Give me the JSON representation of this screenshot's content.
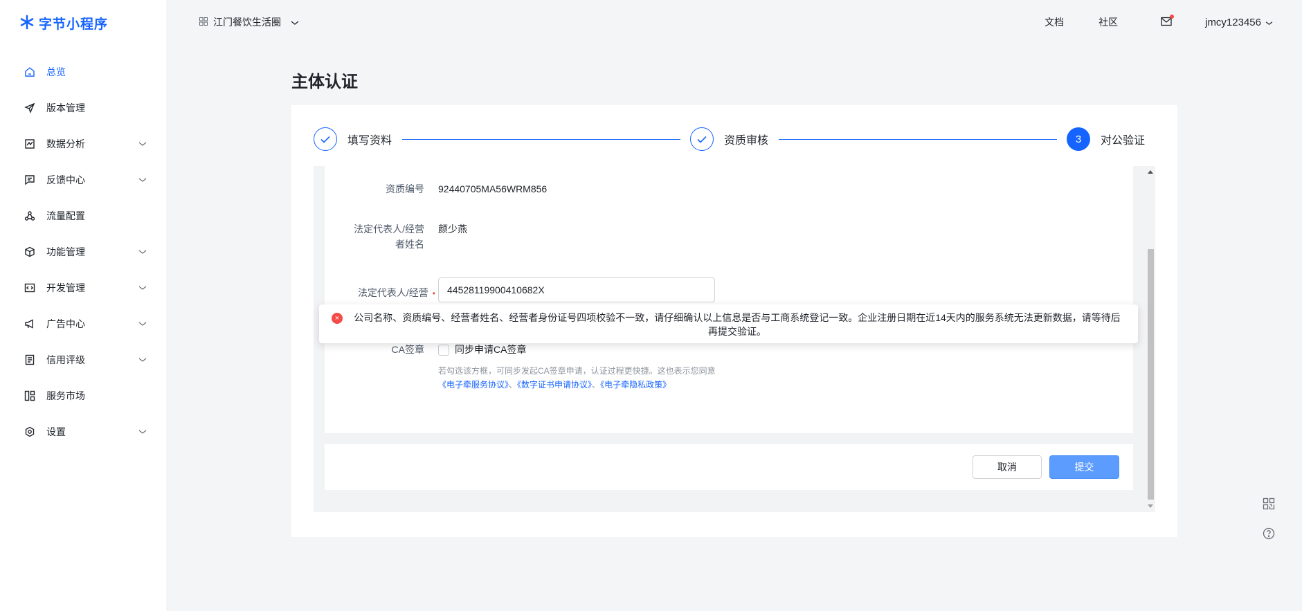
{
  "app": {
    "logo_text": "字节小程序",
    "brand_color": "#1664ff"
  },
  "sidebar": {
    "items": [
      {
        "label": "总览",
        "icon": "home-icon",
        "active": true,
        "expandable": false
      },
      {
        "label": "版本管理",
        "icon": "send-icon",
        "active": false,
        "expandable": false
      },
      {
        "label": "数据分析",
        "icon": "chart-icon",
        "active": false,
        "expandable": true
      },
      {
        "label": "反馈中心",
        "icon": "message-icon",
        "active": false,
        "expandable": true
      },
      {
        "label": "流量配置",
        "icon": "share-icon",
        "active": false,
        "expandable": false
      },
      {
        "label": "功能管理",
        "icon": "cube-icon",
        "active": false,
        "expandable": true
      },
      {
        "label": "开发管理",
        "icon": "code-icon",
        "active": false,
        "expandable": true
      },
      {
        "label": "广告中心",
        "icon": "megaphone-icon",
        "active": false,
        "expandable": true
      },
      {
        "label": "信用评级",
        "icon": "document-icon",
        "active": false,
        "expandable": true
      },
      {
        "label": "服务市场",
        "icon": "grid-icon",
        "active": false,
        "expandable": false
      },
      {
        "label": "设置",
        "icon": "settings-icon",
        "active": false,
        "expandable": true
      }
    ]
  },
  "header": {
    "app_name": "江门餐饮生活圈",
    "docs_label": "文档",
    "community_label": "社区",
    "username": "jmcy123456"
  },
  "page": {
    "title": "主体认证"
  },
  "steps": [
    {
      "label": "填写资料",
      "status": "done"
    },
    {
      "label": "资质审核",
      "status": "done"
    },
    {
      "label": "对公验证",
      "status": "current",
      "number": "3"
    }
  ],
  "form": {
    "qualification_no_label": "资质编号",
    "qualification_no_value": "92440705MA56WRM856",
    "legal_name_label_line1": "法定代表人/经营",
    "legal_name_label_line2": "者姓名",
    "legal_name_value": "颜少燕",
    "legal_id_label": "法定代表人/经营",
    "required_mark": "•",
    "legal_id_value": "44528119900410682X",
    "ca_label": "CA签章",
    "ca_checkbox_label": "同步申请CA签章",
    "ca_checked": false,
    "ca_hint": "若勾选该方框，可同步发起CA签章申请，认证过程更快捷。这也表示您同意",
    "link_1": "《电子牵服务协议》",
    "link_sep_1": "、",
    "link_2": "《数字证书申请协议》",
    "link_sep_2": "、",
    "link_3": "《电子牵隐私政策》"
  },
  "actions": {
    "cancel_label": "取消",
    "submit_label": "提交"
  },
  "toast": {
    "type": "error",
    "message": "公司名称、资质编号、经营者姓名、经营者身份证号四项校验不一致，请仔细确认以上信息是否与工商系统登记一致。企业注册日期在近14天内的服务系统无法更新数据，请等待后再提交验证。",
    "error_color": "#f54a45"
  }
}
